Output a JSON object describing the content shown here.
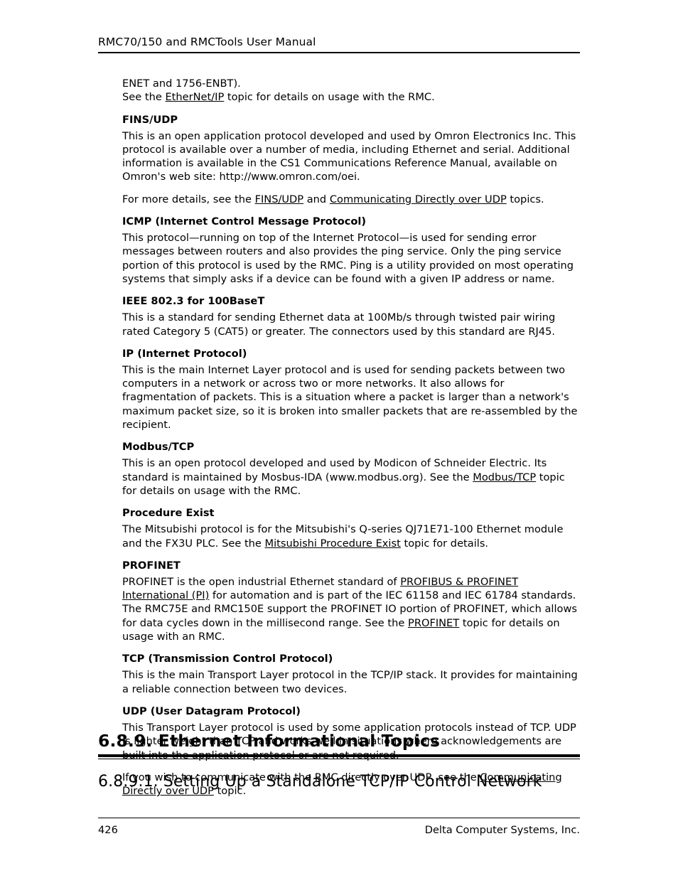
{
  "header": {
    "title": "RMC70/150 and RMCTools User Manual"
  },
  "content": {
    "intro": {
      "line1": "ENET and 1756-ENBT).",
      "line2_pre": "See the ",
      "line2_link": "EtherNet/IP",
      "line2_post": " topic for details on usage with the RMC."
    },
    "sections": [
      {
        "heading": "FINS/UDP",
        "paragraphs": [
          "This is an open application protocol developed and used by Omron Electronics Inc.  This protocol is available over a number of media, including Ethernet and serial.  Additional information is available in the CS1 Communications Reference Manual, available on Omron's web site: http://www.omron.com/oei."
        ],
        "link_paragraph": {
          "pre": "For more details, see the ",
          "link1": "FINS/UDP",
          "mid": " and ",
          "link2": "Communicating Directly over UDP",
          "post": " topics."
        }
      },
      {
        "heading": "ICMP (Internet Control Message Protocol)",
        "paragraphs": [
          "This protocol—running on top of the Internet Protocol—is used for sending error messages between routers and also provides the ping service.  Only the ping service portion of this protocol is used by the RMC.  Ping is a utility provided on most operating systems that simply asks if a device can be found with a given IP address or name."
        ]
      },
      {
        "heading": "IEEE 802.3 for 100BaseT",
        "paragraphs": [
          "This is a standard for sending Ethernet data at 100Mb/s through twisted pair wiring rated Category 5 (CAT5) or greater.  The connectors used by this standard are RJ45."
        ]
      },
      {
        "heading": "IP (Internet Protocol)",
        "paragraphs": [
          "This is the main Internet Layer protocol and is used for sending packets between two computers in a network or across two or more networks.  It also allows for fragmentation of packets.  This is a situation where a packet is larger than a network's maximum packet size, so it is broken into smaller packets that are re-assembled by the recipient."
        ]
      },
      {
        "heading": "Modbus/TCP",
        "modbus": {
          "pre": "This is an open protocol developed and used by Modicon of Schneider Electric.  Its standard is maintained by Mosbus-IDA (www.modbus.org). See the ",
          "link": "Modbus/TCP",
          "post": " topic for details on usage with the RMC."
        }
      },
      {
        "heading": "Procedure Exist",
        "procedure": {
          "pre": "The Mitsubishi protocol is for the Mitsubishi's Q-series QJ71E71-100 Ethernet module and the FX3U PLC. See the ",
          "link": "Mitsubishi Procedure Exist",
          "post": " topic for details."
        }
      },
      {
        "heading": "PROFINET",
        "profinet": {
          "pre": "PROFINET is the open industrial Ethernet standard of ",
          "link1": "PROFIBUS & PROFINET International (PI)",
          "mid": " for automation and is part of the IEC 61158 and IEC 61784 standards. The RMC75E and RMC150E support the PROFINET IO portion of PROFINET, which allows for data cycles down in the millisecond range. See the ",
          "link2": "PROFINET",
          "post": " topic for details on usage with an RMC."
        }
      },
      {
        "heading": "TCP (Transmission Control Protocol)",
        "paragraphs": [
          "This is the main Transport Layer protocol in the TCP/IP stack. It provides for maintaining a reliable connection between two devices."
        ]
      },
      {
        "heading": "UDP (User Datagram Protocol)",
        "paragraphs": [
          "This Transport Layer protocol is used by some application protocols instead of TCP. UDP is lighter weight than TCP and works well in situations where acknowledgements are built into the application protocol or are not required."
        ],
        "udp_link_paragraph": {
          "pre": "If you wish to communicate with the RMC directly over UDP, see the ",
          "link": "Communicating Directly over UDP",
          "post": " topic."
        }
      }
    ]
  },
  "section_heading_1": "6.8.9. Ethernet Informational Topics",
  "section_heading_2": "6.8.9.1. Setting Up a Standalone TCP/IP Control Network",
  "footer": {
    "page_number": "426",
    "company": "Delta Computer Systems, Inc."
  }
}
